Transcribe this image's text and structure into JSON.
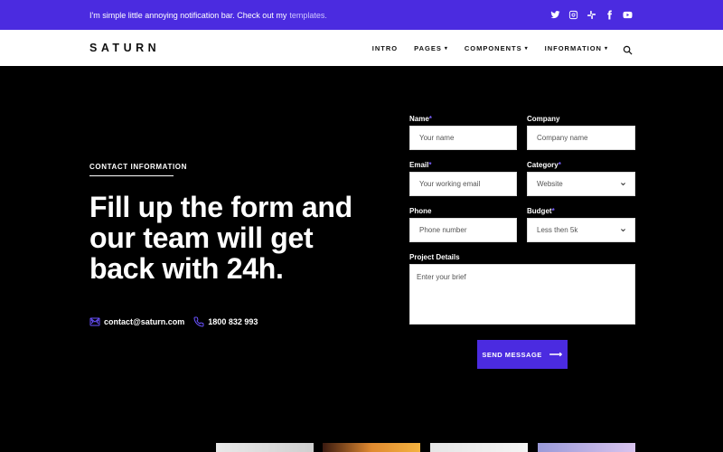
{
  "notification": {
    "text": "I'm simple little annoying notification bar. Check out my",
    "link": "templates."
  },
  "socials": [
    "twitter-icon",
    "instagram-icon",
    "slack-icon",
    "facebook-icon",
    "youtube-icon"
  ],
  "header": {
    "logo": "SATURN",
    "nav": [
      {
        "label": "INTRO",
        "dropdown": false
      },
      {
        "label": "PAGES",
        "dropdown": true
      },
      {
        "label": "COMPONENTS",
        "dropdown": true
      },
      {
        "label": "INFORMATION",
        "dropdown": true
      }
    ]
  },
  "hero": {
    "eyebrow": "CONTACT INFORMATION",
    "headline": "Fill up the form and our team will get back with 24h.",
    "email": "contact@saturn.com",
    "phone": "1800 832 993"
  },
  "form": {
    "name": {
      "label": "Name",
      "placeholder": "Your name"
    },
    "company": {
      "label": "Company",
      "placeholder": "Company name"
    },
    "email": {
      "label": "Email",
      "placeholder": "Your working email"
    },
    "category": {
      "label": "Category",
      "value": "Website"
    },
    "phone": {
      "label": "Phone",
      "placeholder": "Phone number"
    },
    "budget": {
      "label": "Budget",
      "value": "Less then 5k"
    },
    "details": {
      "label": "Project Details",
      "placeholder": "Enter your brief"
    },
    "submit": "SEND MESSAGE"
  },
  "colors": {
    "accent": "#4b2be0",
    "background": "#000000"
  }
}
